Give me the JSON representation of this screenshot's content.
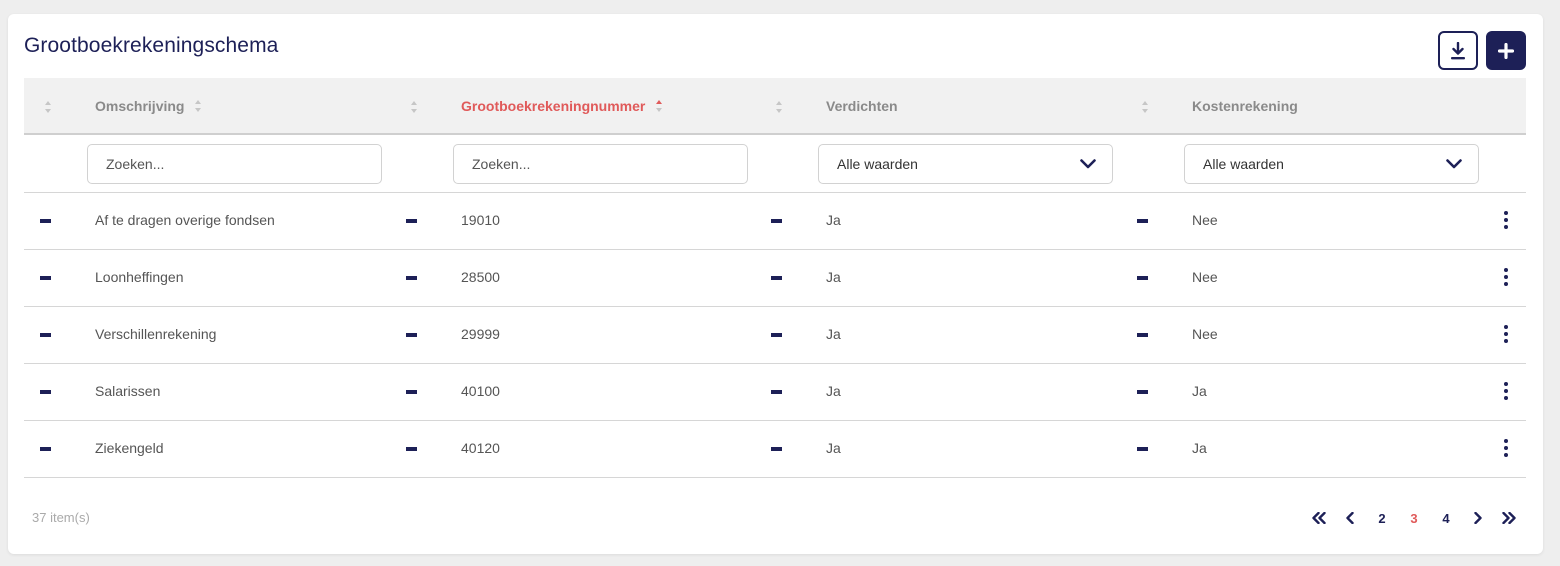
{
  "title": "Grootboekrekeningschema",
  "actions": {
    "download_icon": "download-icon",
    "add_icon": "plus-icon"
  },
  "columns": [
    {
      "label": "",
      "sortable": true
    },
    {
      "label": "Omschrijving",
      "sortable": true,
      "sorted": false
    },
    {
      "label": "",
      "sortable": true
    },
    {
      "label": "Grootboekrekeningnummer",
      "sortable": true,
      "sorted": "asc"
    },
    {
      "label": "",
      "sortable": true
    },
    {
      "label": "Verdichten",
      "sortable": false
    },
    {
      "label": "",
      "sortable": true
    },
    {
      "label": "Kostenrekening",
      "sortable": false
    }
  ],
  "filters": {
    "omschrijving": {
      "placeholder": "Zoeken..."
    },
    "nummer": {
      "placeholder": "Zoeken..."
    },
    "verdichten": {
      "value": "Alle waarden"
    },
    "kostenrekening": {
      "value": "Alle waarden"
    }
  },
  "rows": [
    {
      "omschrijving": "Af te dragen overige fondsen",
      "nummer": "19010",
      "verdichten": "Ja",
      "kostenrekening": "Nee"
    },
    {
      "omschrijving": "Loonheffingen",
      "nummer": "28500",
      "verdichten": "Ja",
      "kostenrekening": "Nee"
    },
    {
      "omschrijving": "Verschillenrekening",
      "nummer": "29999",
      "verdichten": "Ja",
      "kostenrekening": "Nee"
    },
    {
      "omschrijving": "Salarissen",
      "nummer": "40100",
      "verdichten": "Ja",
      "kostenrekening": "Ja"
    },
    {
      "omschrijving": "Ziekengeld",
      "nummer": "40120",
      "verdichten": "Ja",
      "kostenrekening": "Ja"
    }
  ],
  "footer": {
    "item_count": "37 item(s)",
    "pages": [
      "2",
      "3",
      "4"
    ],
    "current_page": "3"
  },
  "colors": {
    "primary": "#1d2057",
    "accent": "#e05a5a",
    "header_bg": "#f1f1f1"
  }
}
